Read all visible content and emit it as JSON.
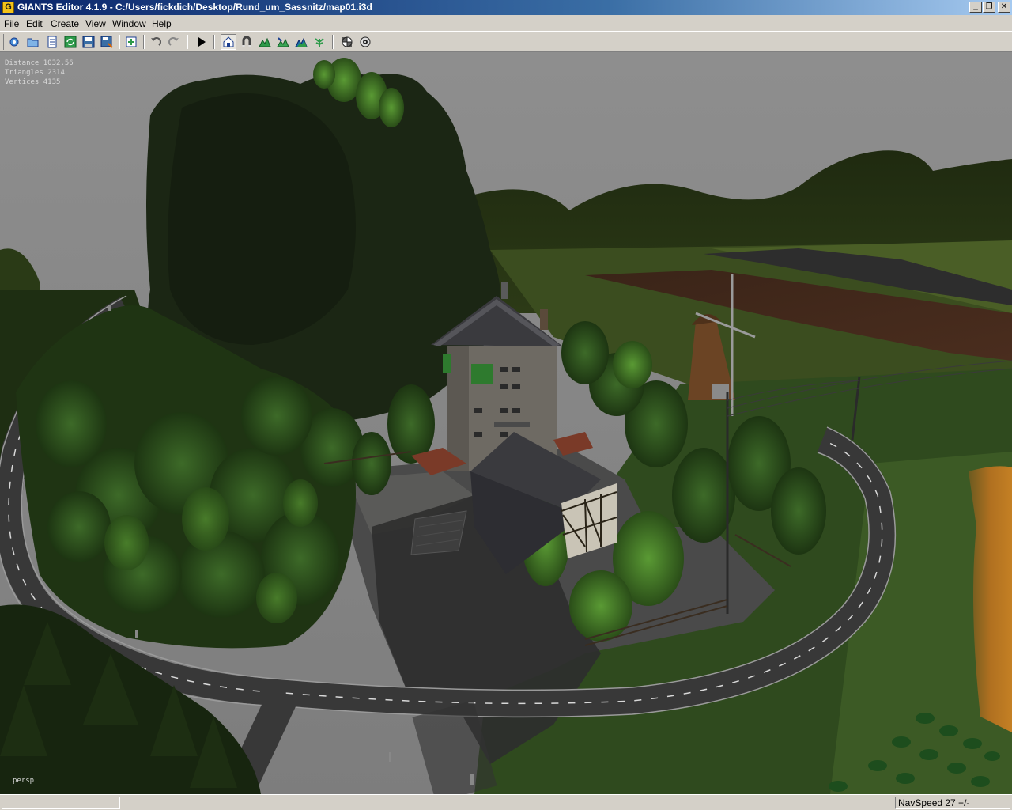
{
  "window": {
    "title": "GIANTS Editor 4.1.9 - C:/Users/fickdich/Desktop/Rund_um_Sassnitz/map01.i3d",
    "icon_letter": "G"
  },
  "menu": {
    "items": [
      "File",
      "Edit",
      "Create",
      "View",
      "Window",
      "Help"
    ]
  },
  "toolbar": {
    "buttons": [
      {
        "name": "new-icon"
      },
      {
        "name": "open-icon"
      },
      {
        "name": "document-icon"
      },
      {
        "name": "refresh-icon"
      },
      {
        "name": "save-icon"
      },
      {
        "name": "save-as-icon"
      },
      {
        "name": "import-icon"
      },
      {
        "name": "undo-icon"
      },
      {
        "name": "redo-icon"
      },
      {
        "name": "play-icon"
      },
      {
        "name": "select-home-icon"
      },
      {
        "name": "magnet-icon"
      },
      {
        "name": "terrain-sculpt-icon"
      },
      {
        "name": "terrain-paint-icon"
      },
      {
        "name": "terrain-smooth-icon"
      },
      {
        "name": "foliage-paint-icon"
      },
      {
        "name": "checker-icon"
      },
      {
        "name": "render-icon"
      }
    ]
  },
  "viewport": {
    "stats": {
      "distance": "Distance 1032.56",
      "triangles": "Triangles 2314",
      "vertices": "Vertices 4135"
    },
    "camera_label": "persp"
  },
  "statusbar": {
    "main": "",
    "navspeed": "NavSpeed 27 +/-"
  },
  "colors": {
    "title_start": "#0a246a",
    "title_end": "#a6caf0",
    "chrome": "#d4d0c8",
    "sky": "#8c8c8c",
    "forest": "#1d2a14",
    "road": "#3b3b3b"
  }
}
